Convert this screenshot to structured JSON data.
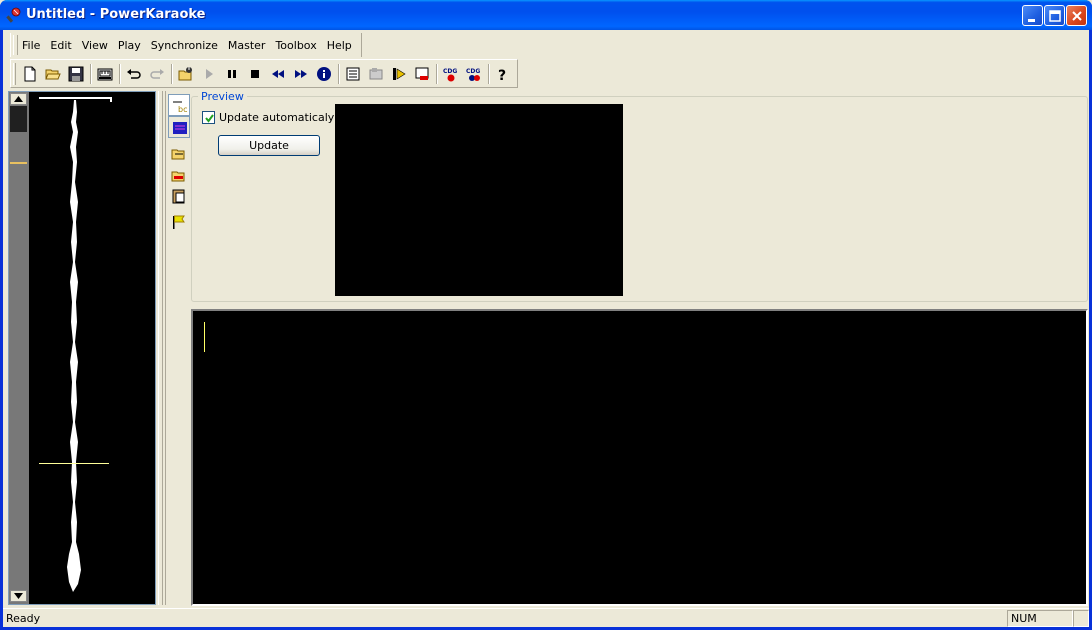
{
  "window": {
    "title": "Untitled - PowerKaraoke"
  },
  "menu": {
    "items": [
      "File",
      "Edit",
      "View",
      "Play",
      "Synchronize",
      "Master",
      "Toolbox",
      "Help"
    ]
  },
  "toolbar": {
    "icons": [
      "new-file-icon",
      "open-folder-icon",
      "save-icon",
      "midi-icon",
      "undo-icon",
      "redo-icon",
      "open-audio-icon",
      "play-icon",
      "pause-icon",
      "stop-icon",
      "rewind-icon",
      "fast-forward-icon",
      "info-icon",
      "lyrics-window-icon",
      "sync-icon",
      "tap-marker-icon",
      "clear-icon",
      "cdg-export-icon",
      "cdg-settings-icon",
      "help-icon"
    ]
  },
  "side_toolbar": {
    "icons": [
      "text-mode-icon",
      "color-mode-icon",
      "import-icon",
      "export-icon",
      "paste-icon",
      "flag-icon"
    ]
  },
  "preview": {
    "legend": "Preview",
    "auto_update_label": "Update automaticaly",
    "auto_update_checked": true,
    "update_button": "Update"
  },
  "status": {
    "text": "Ready",
    "num": "NUM"
  },
  "colors": {
    "titlebar": "#0054e3",
    "legend": "#0046d5",
    "cursor": "#ffff66"
  }
}
